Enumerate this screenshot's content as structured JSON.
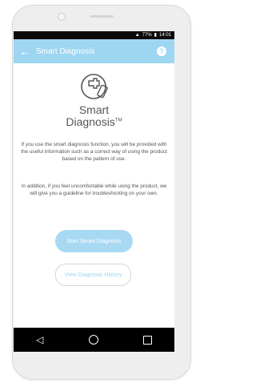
{
  "statusbar": {
    "signal_icon": "signal-icon",
    "battery_text": "77%",
    "time": "14:01"
  },
  "appbar": {
    "title": "Smart Diagnosis",
    "back_icon": "arrow-left-icon",
    "help_icon": "?"
  },
  "brand": {
    "line1": "Smart",
    "line2": "Diagnosis",
    "tm": "TM"
  },
  "description": {
    "para1": "If you use the smart diagnosis function, you will be provided with the useful information such as a correct way of using the product based on the pattern of use.",
    "para2": "In addition, if you feel uncomfortable while using the product, we will give you a guideline for troubleshooting on your own."
  },
  "buttons": {
    "start": "Start Smart Diagnosis",
    "history": "View Diagnosis History"
  },
  "colors": {
    "accent": "#9ed6f2",
    "text": "#555555"
  }
}
